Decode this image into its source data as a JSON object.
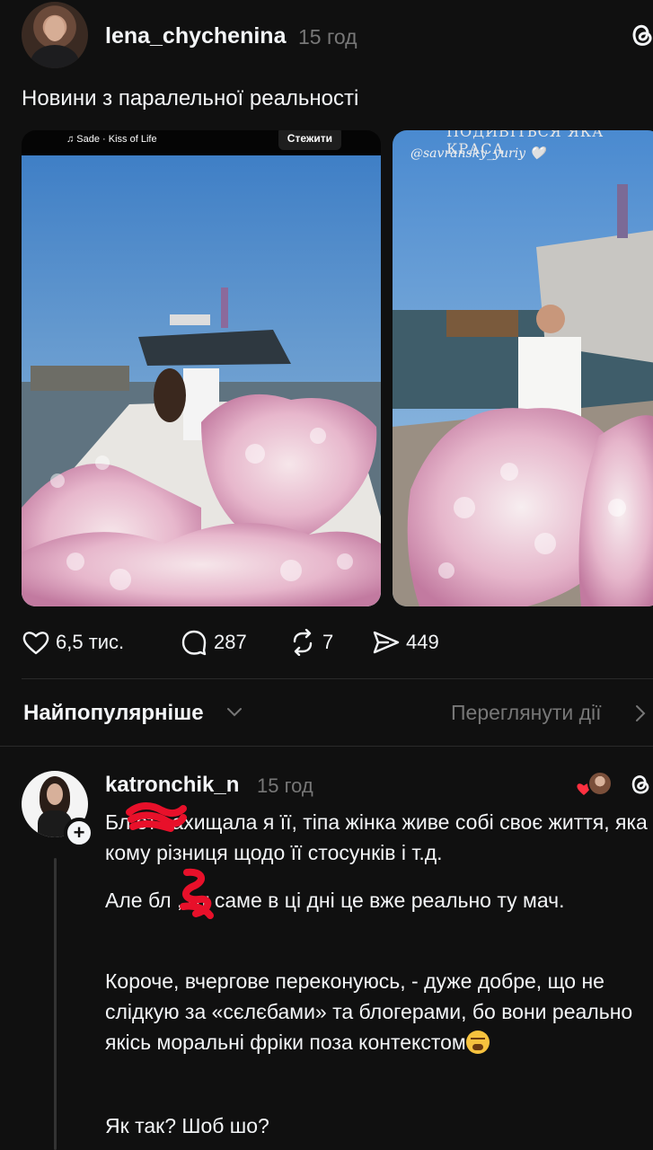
{
  "post": {
    "username": "lena_chychenina",
    "time": "15 год",
    "text": "Новини з паралельної реальності",
    "media": [
      {
        "music": "♫ Sade · Kiss of Life",
        "follow_label": "Стежити"
      },
      {
        "handle": "@savransky_yuriy 🤍",
        "top_text": "ПОДИВІТЬСЯ ЯКА КРАСА"
      }
    ],
    "stats": {
      "likes": "6,5 тис.",
      "comments": "287",
      "reposts": "7",
      "shares": "449"
    }
  },
  "sort": {
    "label": "Найпопулярніше",
    "activity_link": "Переглянути дії"
  },
  "reply": {
    "username": "katronchik_n",
    "time": "15 год",
    "paragraphs": [
      "Бл      от захищала я її, тіпа жінка живе собі своє життя, яка кому різниця щодо її стосунків і т.д.",
      "Але бл      , от саме в ці дні це вже реально ту мач.",
      "Короче, вчергове переконуюсь, - дуже добре, що не слідкую за «сєлєбами» та блогерами, бо вони реально якісь моральні фріки поза контекстом",
      "Як так? Шоб шо?"
    ]
  },
  "colors": {
    "background": "#101010",
    "text": "#f3f5f7",
    "muted": "#777777",
    "scribble": "#e8102a"
  }
}
